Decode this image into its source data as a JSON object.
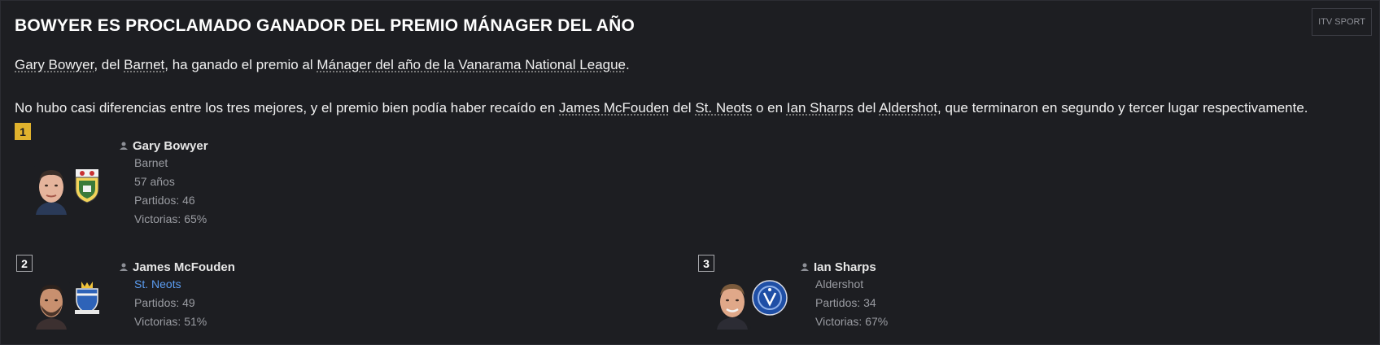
{
  "article": {
    "title": "BOWYER ES PROCLAMADO GANADOR DEL PREMIO MÁNAGER DEL AÑO",
    "source": "ITV SPORT",
    "paragraph1": {
      "manager": "Gary Bowyer",
      "t1": ", del ",
      "club": "Barnet",
      "t2": ", ha ganado el premio al ",
      "award": "Mánager del año de la Vanarama National League",
      "t3": "."
    },
    "paragraph2": {
      "t1": "No hubo casi diferencias entre los tres mejores, y el premio bien podía haber recaído en ",
      "manager2": "James McFouden",
      "t2": " del ",
      "club2": "St. Neots",
      "t3": " o en ",
      "manager3": "Ian Sharps",
      "t4": " del ",
      "club3": "Aldershot",
      "t5": ", que terminaron en segundo y tercer lugar respectivamente."
    }
  },
  "winners": [
    {
      "rank": "1",
      "name": "Gary Bowyer",
      "club": "Barnet",
      "age": "57 años",
      "matches": "Partidos: 46",
      "wins": "Victorias: 65%"
    },
    {
      "rank": "2",
      "name": "James McFouden",
      "club": "St. Neots",
      "matches": "Partidos: 49",
      "wins": "Victorias: 51%"
    },
    {
      "rank": "3",
      "name": "Ian Sharps",
      "club": "Aldershot",
      "matches": "Partidos: 34",
      "wins": "Victorias: 67%"
    }
  ],
  "colors": {
    "gold": "#e0b22d",
    "link_blue": "#5b9cf0",
    "background": "#1d1e22"
  },
  "icons": [
    "person-icon",
    "club-crest"
  ]
}
